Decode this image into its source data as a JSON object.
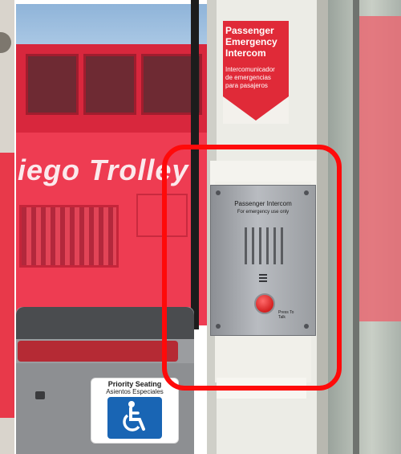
{
  "scene": {
    "bus_side_text": "iego Trolley",
    "sign": {
      "title_lines": [
        "Passenger",
        "Emergency",
        "Intercom"
      ],
      "spanish_lines": [
        "Intercomunicador",
        "de emergencias",
        "para pasajeros"
      ]
    },
    "intercom_plate": {
      "title": "Passenger Intercom",
      "subtitle": "For emergency use only",
      "press_text": [
        "Press To",
        "Talk"
      ]
    },
    "priority_sign": {
      "title": "Priority Seating",
      "subtitle": "Asientos Especiales"
    },
    "highlight_color": "#ff0a0a"
  }
}
